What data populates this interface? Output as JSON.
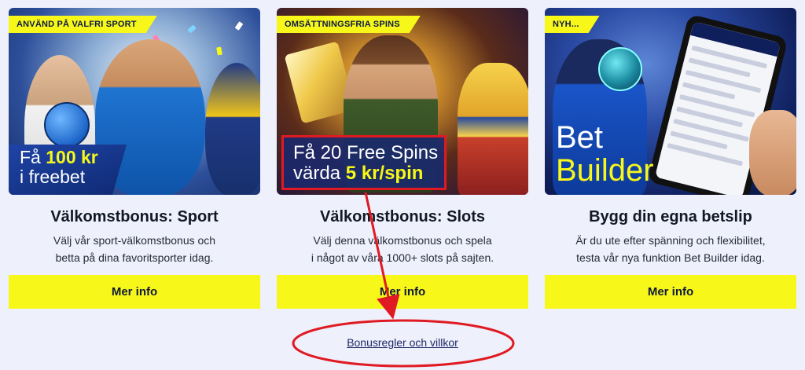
{
  "cards": [
    {
      "tag": "ANVÄND PÅ VALFRI SPORT",
      "hero_line1_prefix": "Få ",
      "hero_line1_bold": "100 kr",
      "hero_line2": "i freebet",
      "title": "Välkomstbonus: Sport",
      "desc_line1": "Välj vår sport-välkomstbonus och",
      "desc_line2": "betta på dina favoritsporter idag.",
      "button_label": "Mer info"
    },
    {
      "tag": "OMSÄTTNINGSFRIA SPINS",
      "hero_line1": "Få 20 Free Spins",
      "hero_line2_prefix": "värda ",
      "hero_line2_bold": "5 kr/spin",
      "title": "Välkomstbonus: Slots",
      "desc_line1": "Välj denna välkomstbonus och spela",
      "desc_line2": "i något av våra 1000+ slots på sajten.",
      "button_label": "Mer info"
    },
    {
      "tag": "NYH...",
      "hero_line1": "Bet",
      "hero_line2": "Builder",
      "title": "Bygg din egna betslip",
      "desc_line1": "Är du ute efter spänning och flexibilitet,",
      "desc_line2": "testa vår nya funktion Bet Builder idag.",
      "button_label": "Mer info"
    }
  ],
  "terms_link": "Bonusregler och villkor",
  "colors": {
    "accent_yellow": "#f7f71a",
    "annotation_red": "#e01a22",
    "page_bg": "#eef0fb"
  }
}
